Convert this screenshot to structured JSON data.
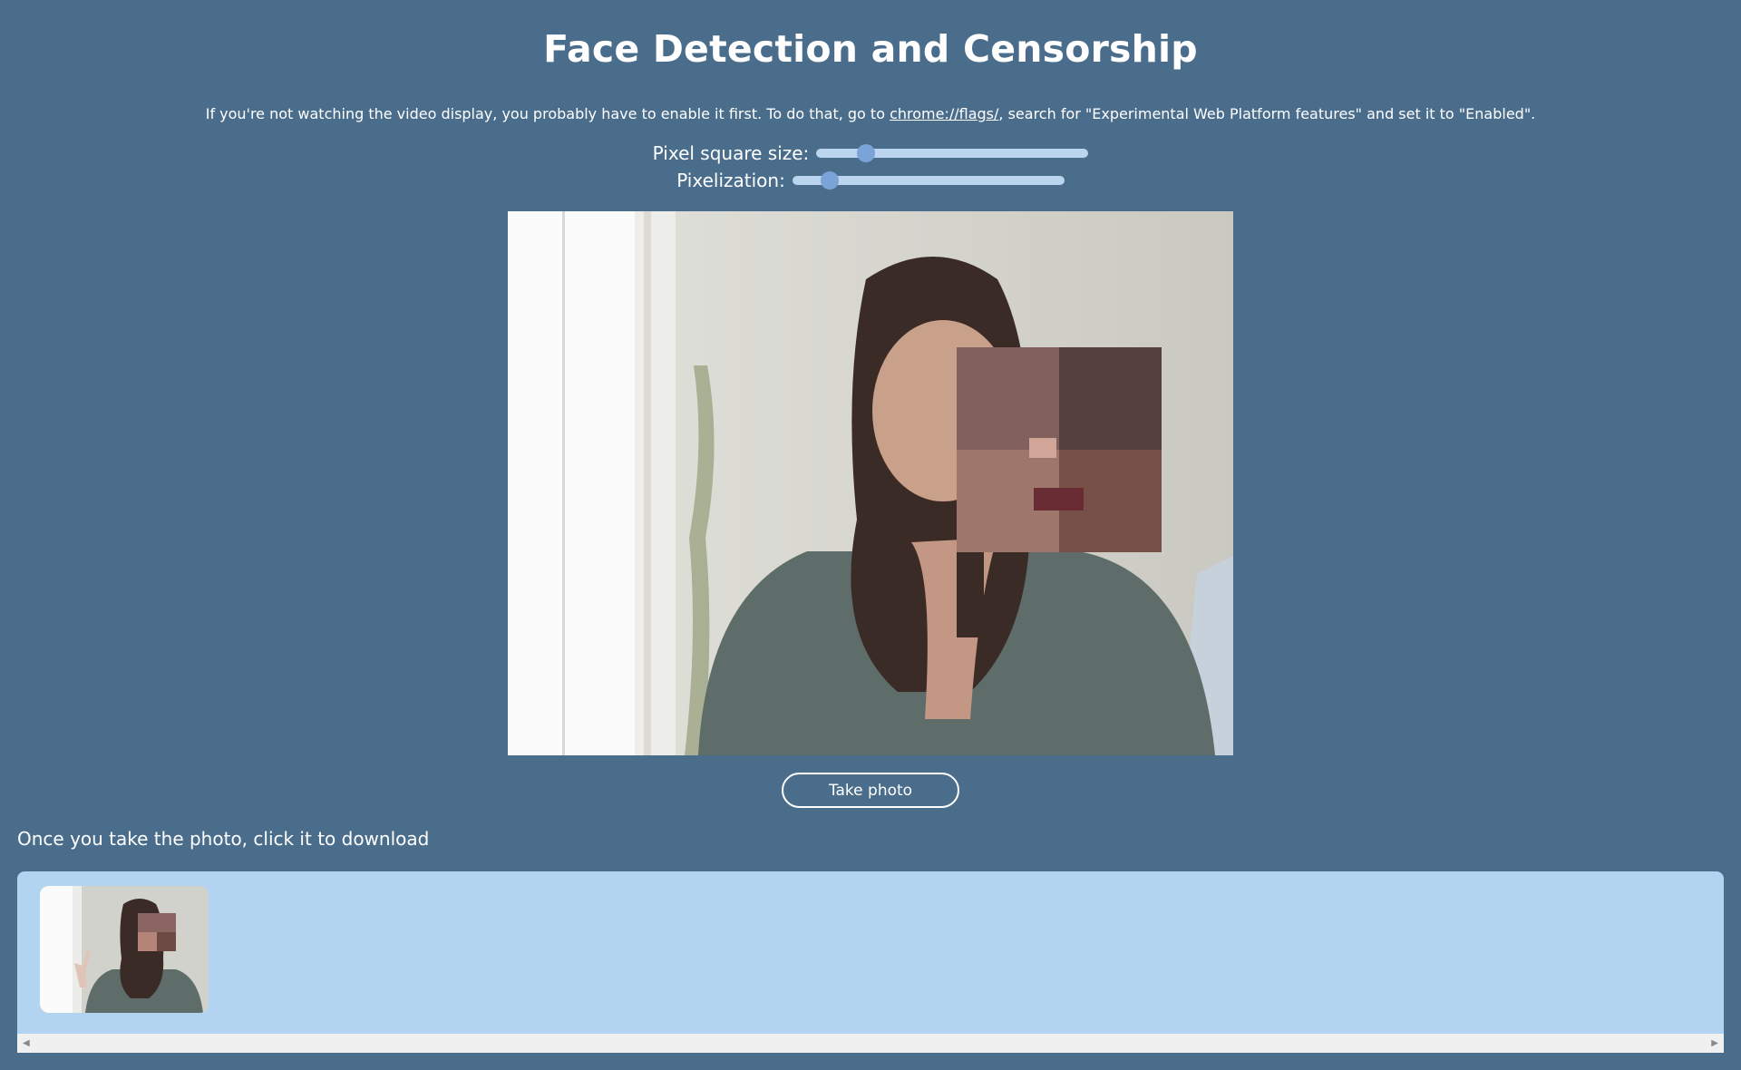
{
  "page": {
    "title": "Face Detection and Censorship",
    "info_prefix": "If you're not watching the video display, you probably have to enable it first. To do that, go to ",
    "info_link": "chrome://flags/",
    "info_suffix": ", search for \"Experimental Web Platform features\" and set it to \"Enabled\"."
  },
  "controls": {
    "pixel_size_label": "Pixel square size:",
    "pixel_size_fraction": 0.16,
    "pixelization_label": "Pixelization:",
    "pixelization_fraction": 0.11
  },
  "actions": {
    "take_photo_label": "Take photo",
    "download_hint": "Once you take the photo, click it to download"
  },
  "colors": {
    "background": "#4a6d8c",
    "accent": "#7aa3d8",
    "gallery": "#b3d4f1"
  },
  "icons": {
    "scroll_left": "scroll-left-arrow-icon",
    "scroll_right": "scroll-right-arrow-icon"
  }
}
